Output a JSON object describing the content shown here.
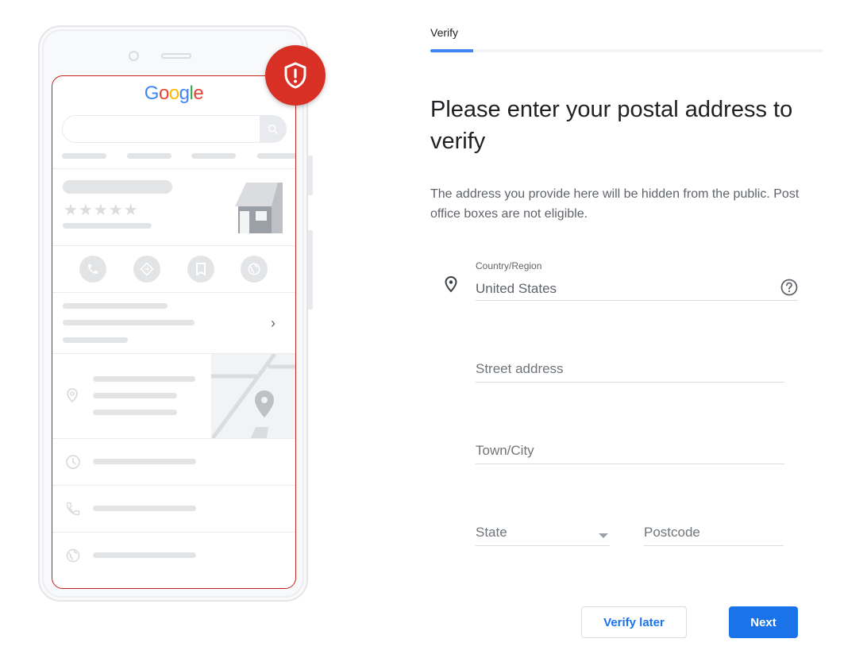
{
  "illustration": {
    "logo_letters": [
      {
        "char": "G",
        "color": "#4285f4"
      },
      {
        "char": "o",
        "color": "#ea4335"
      },
      {
        "char": "o",
        "color": "#fbbc05"
      },
      {
        "char": "g",
        "color": "#4285f4"
      },
      {
        "char": "l",
        "color": "#34a853"
      },
      {
        "char": "e",
        "color": "#ea4335"
      }
    ],
    "rating_stars": "★★★★★",
    "chevron": "›",
    "action_icons": [
      "phone-icon",
      "directions-icon",
      "bookmark-icon",
      "website-icon"
    ],
    "badge_icon": "shield-alert-icon",
    "badge_color": "#d93025"
  },
  "header": {
    "step_label": "Verify",
    "progress_percent": 11
  },
  "main": {
    "title": "Please enter your postal address to verify",
    "description": "The address you provide here will be hidden from the public. Post office boxes are not eligible."
  },
  "form": {
    "country": {
      "label": "Country/Region",
      "value": "United States"
    },
    "street": {
      "placeholder": "Street address",
      "value": ""
    },
    "city": {
      "placeholder": "Town/City",
      "value": ""
    },
    "state": {
      "placeholder": "State",
      "value": ""
    },
    "postcode": {
      "placeholder": "Postcode",
      "value": ""
    }
  },
  "actions": {
    "verify_later_label": "Verify later",
    "next_label": "Next"
  },
  "colors": {
    "accent": "#1a73e8",
    "progress": "#4285f4",
    "alert": "#d93025"
  }
}
